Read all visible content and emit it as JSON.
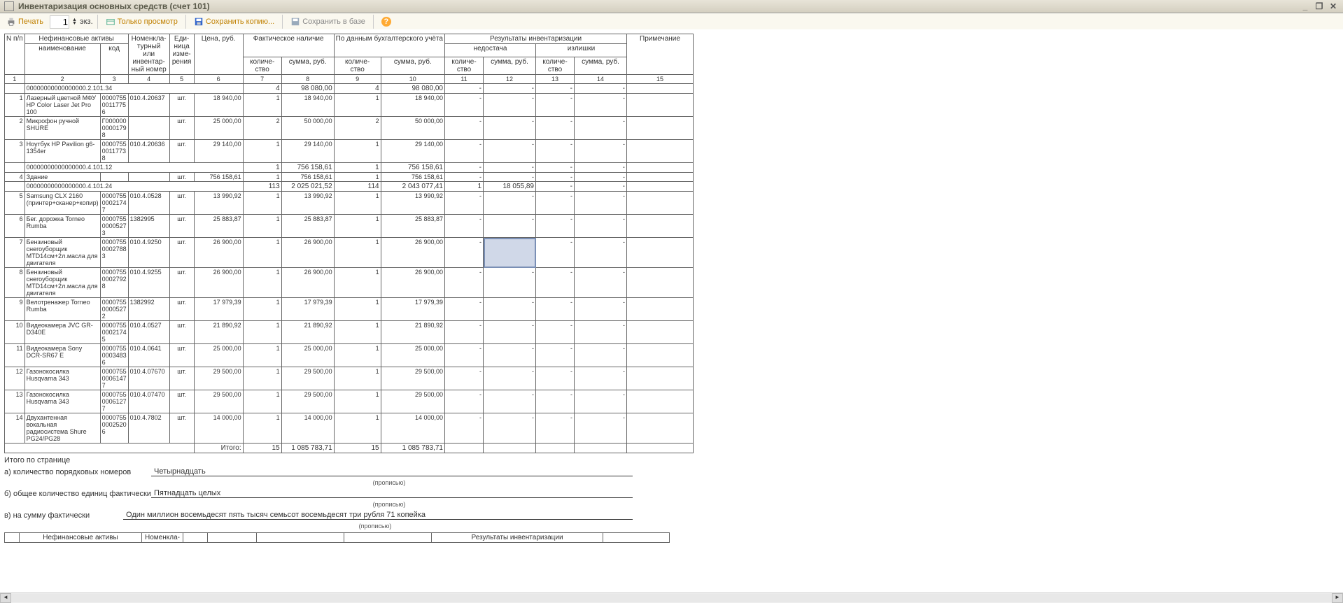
{
  "title": "Инвентаризация основных средств (счет 101)",
  "toolbar": {
    "print": "Печать",
    "copies_value": "1",
    "copies_label": "экз.",
    "readonly": "Только просмотр",
    "save_copy": "Сохранить копию...",
    "save_db": "Сохранить в базе"
  },
  "headers": {
    "npp": "N п/п",
    "nfa": "Нефинансовые активы",
    "name": "наименование",
    "code": "код",
    "nomen": "Номенкла-\nтурный\nили\nинвентар-\nный номер",
    "unit": "Еди-\nница\nизме-\nрения",
    "price": "Цена, руб.",
    "actual": "Фактическое наличие",
    "qty": "количе-\nство",
    "sum": "сумма, руб.",
    "accounting": "По данным бухгалтерского учёта",
    "results": "Результаты инвентаризации",
    "shortage": "недостача",
    "surplus": "излишки",
    "note": "Примечание"
  },
  "col_nums": [
    "1",
    "2",
    "3",
    "4",
    "5",
    "6",
    "7",
    "8",
    "9",
    "10",
    "11",
    "12",
    "13",
    "14",
    "15"
  ],
  "groups": [
    {
      "label": "00000000000000000.2.101.34",
      "aq": "4",
      "as": "98 080,00",
      "bq": "4",
      "bs": "98 080,00",
      "rows": [
        {
          "n": "1",
          "name": "Лазерный цветной МФУ HP Color Laser Jet Pro 100",
          "code": "0000755\n0011775\n6",
          "inv": "010.4.20637",
          "u": "шт.",
          "price": "18 940,00",
          "aq": "1",
          "as": "18 940,00",
          "bq": "1",
          "bs": "18 940,00"
        },
        {
          "n": "2",
          "name": "Микрофон ручной SHURE",
          "code": "Г000000\n0000179\n8",
          "inv": "",
          "u": "шт.",
          "price": "25 000,00",
          "aq": "2",
          "as": "50 000,00",
          "bq": "2",
          "bs": "50 000,00"
        },
        {
          "n": "3",
          "name": "Ноутбук HP Pavilion g6-1354er",
          "code": "0000755\n0011773\n8",
          "inv": "010.4.20636",
          "u": "шт.",
          "price": "29 140,00",
          "aq": "1",
          "as": "29 140,00",
          "bq": "1",
          "bs": "29 140,00"
        }
      ]
    },
    {
      "label": "00000000000000000.4.101.12",
      "aq": "1",
      "as": "756 158,61",
      "bq": "1",
      "bs": "756 158,61",
      "rows": [
        {
          "n": "4",
          "name": "Здание",
          "code": "",
          "inv": "",
          "u": "шт.",
          "price": "756 158,61",
          "aq": "1",
          "as": "756 158,61",
          "bq": "1",
          "bs": "756 158,61"
        }
      ]
    },
    {
      "label": "00000000000000000.4.101.24",
      "aq": "113",
      "as": "2 025 021,52",
      "bq": "114",
      "bs": "2 043 077,41",
      "nq": "1",
      "ns": "18 055,89",
      "rows": [
        {
          "n": "5",
          "name": "Samsung  CLX 2160 (принтер+сканер+копир)",
          "code": "0000755\n0002174\n7",
          "inv": "010.4.0528",
          "u": "шт.",
          "price": "13 990,92",
          "aq": "1",
          "as": "13 990,92",
          "bq": "1",
          "bs": "13 990,92"
        },
        {
          "n": "6",
          "name": "Бег. дорожка Torneo Rumba",
          "code": "0000755\n0000527\n3",
          "inv": "1382995",
          "u": "шт.",
          "price": "25 883,87",
          "aq": "1",
          "as": "25 883,87",
          "bq": "1",
          "bs": "25 883,87"
        },
        {
          "n": "7",
          "name": "Бензиновый снегоуборщик MTD14см+2л.масла для двигателя",
          "code": "0000755\n0002788\n3",
          "inv": "010.4.9250",
          "u": "шт.",
          "price": "26 900,00",
          "aq": "1",
          "as": "26 900,00",
          "bq": "1",
          "bs": "26 900,00",
          "sel": true
        },
        {
          "n": "8",
          "name": "Бензиновый снегоуборщик MTD14см+2л.масла для двигателя",
          "code": "0000755\n0002792\n8",
          "inv": "010.4.9255",
          "u": "шт.",
          "price": "26 900,00",
          "aq": "1",
          "as": "26 900,00",
          "bq": "1",
          "bs": "26 900,00"
        },
        {
          "n": "9",
          "name": "Велотренажер Torneo Rumba",
          "code": "0000755\n0000527\n2",
          "inv": "1382992",
          "u": "шт.",
          "price": "17 979,39",
          "aq": "1",
          "as": "17 979,39",
          "bq": "1",
          "bs": "17 979,39"
        },
        {
          "n": "10",
          "name": "Видеокамера JVC GR-D340E",
          "code": "0000755\n0002174\n5",
          "inv": "010.4.0527",
          "u": "шт.",
          "price": "21 890,92",
          "aq": "1",
          "as": "21 890,92",
          "bq": "1",
          "bs": "21 890,92"
        },
        {
          "n": "11",
          "name": "Видеокамера Sony DCR-SR67 E",
          "code": "0000755\n0003483\n6",
          "inv": "010.4.0641",
          "u": "шт.",
          "price": "25 000,00",
          "aq": "1",
          "as": "25 000,00",
          "bq": "1",
          "bs": "25 000,00"
        },
        {
          "n": "12",
          "name": "Газонокосилка Husqvarna 343",
          "code": "0000755\n0006147\n7",
          "inv": "010.4.07670",
          "u": "шт.",
          "price": "29 500,00",
          "aq": "1",
          "as": "29 500,00",
          "bq": "1",
          "bs": "29 500,00"
        },
        {
          "n": "13",
          "name": "Газонокосилка Husqvarna 343",
          "code": "0000755\n0006127\n7",
          "inv": "010.4.07470",
          "u": "шт.",
          "price": "29 500,00",
          "aq": "1",
          "as": "29 500,00",
          "bq": "1",
          "bs": "29 500,00"
        },
        {
          "n": "14",
          "name": "Двухантенная вокальная радиосистема Shure PG24/PG28",
          "code": "0000755\n0002520\n6",
          "inv": "010.4.7802",
          "u": "шт.",
          "price": "14 000,00",
          "aq": "1",
          "as": "14 000,00",
          "bq": "1",
          "bs": "14 000,00"
        }
      ]
    }
  ],
  "itogo": {
    "label": "Итого:",
    "aq": "15",
    "as": "1 085 783,71",
    "bq": "15",
    "bs": "1 085 783,71"
  },
  "totals": {
    "title": "Итого по странице",
    "a_label": "а) количество порядковых номеров",
    "a_val": "Четырнадцать",
    "b_label": "б) общее  количество единиц фактически",
    "b_val": "Пятнадцать целых",
    "c_label": "в) на сумму фактически",
    "c_val": "Один миллион восемьдесят пять тысяч семьсот восемьдесят три рубля 71 копейка",
    "hint": "(прописью)"
  },
  "footer_hdr": {
    "nfa": "Нефинансовые активы",
    "nomen": "Номенкла-",
    "results": "Результаты инвентаризации"
  }
}
